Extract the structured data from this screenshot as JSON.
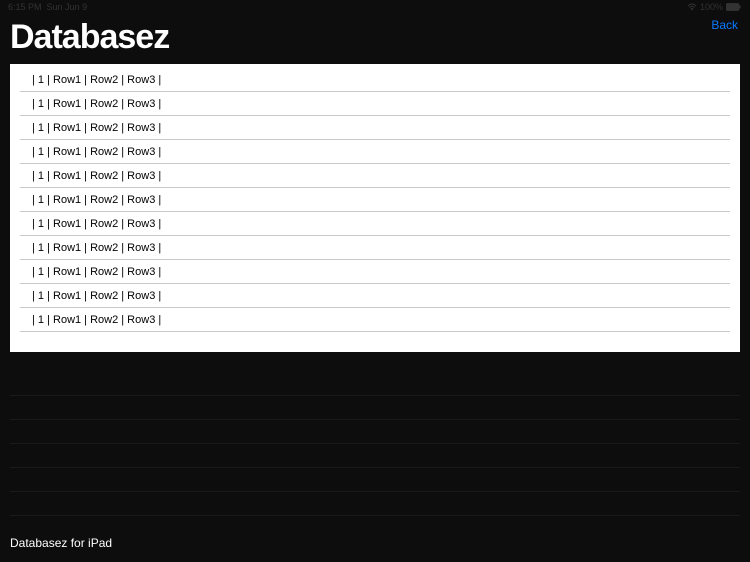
{
  "statusBar": {
    "time": "6:15 PM",
    "date": "Sun Jun 9",
    "battery": "100%"
  },
  "header": {
    "title": "Databasez",
    "back": "Back"
  },
  "rows": [
    {
      "text": "| 1 | Row1 | Row2 | Row3 |"
    },
    {
      "text": "| 1 | Row1 | Row2 | Row3 |"
    },
    {
      "text": "| 1 | Row1 | Row2 | Row3 |"
    },
    {
      "text": "| 1 | Row1 | Row2 | Row3 |"
    },
    {
      "text": "| 1 | Row1 | Row2 | Row3 |"
    },
    {
      "text": "| 1 | Row1 | Row2 | Row3 |"
    },
    {
      "text": "| 1 | Row1 | Row2 | Row3 |"
    },
    {
      "text": "| 1 | Row1 | Row2 | Row3 |"
    },
    {
      "text": "| 1 | Row1 | Row2 | Row3 |"
    },
    {
      "text": "| 1 | Row1 | Row2 | Row3 |"
    },
    {
      "text": "| 1 | Row1 | Row2 | Row3 |"
    }
  ],
  "footer": {
    "text": "Databasez for iPad"
  }
}
